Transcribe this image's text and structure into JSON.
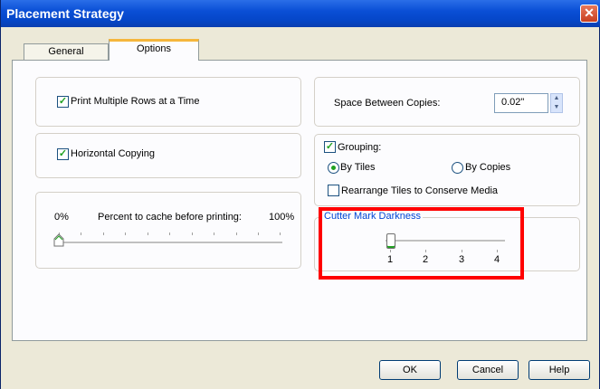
{
  "window": {
    "title": "Placement Strategy",
    "close_glyph": "✕"
  },
  "tabs": [
    {
      "label": "General"
    },
    {
      "label": "Options"
    }
  ],
  "options": {
    "print_multiple_rows": {
      "label": "Print Multiple Rows at a Time",
      "checked": true
    },
    "horizontal_copying": {
      "label": "Horizontal Copying",
      "checked": true
    },
    "cache": {
      "min_label": "0%",
      "label": "Percent to cache before printing:",
      "max_label": "100%",
      "value_percent": 0
    },
    "space_between_copies": {
      "label": "Space Between Copies:",
      "value": "0.02\""
    },
    "grouping": {
      "label": "Grouping:",
      "checked": true,
      "by_tiles": "By Tiles",
      "by_copies": "By Copies",
      "selected": "By Tiles",
      "rearrange": {
        "label": "Rearrange Tiles to Conserve Media",
        "checked": false
      }
    },
    "cutter_mark": {
      "label": "Cutter Mark Darkness",
      "ticks": [
        "1",
        "2",
        "3",
        "4"
      ],
      "value": 1
    }
  },
  "buttons": {
    "ok": "OK",
    "cancel": "Cancel",
    "help": "Help"
  },
  "colors": {
    "title_bar": "#0a4fd6",
    "tab_accent": "#f5b63c",
    "highlight": "#ff0000",
    "check": "#21a121",
    "group_label": "#0046d5"
  },
  "icons": {
    "check": "✓",
    "spin_up": "▲",
    "spin_down": "▼"
  }
}
